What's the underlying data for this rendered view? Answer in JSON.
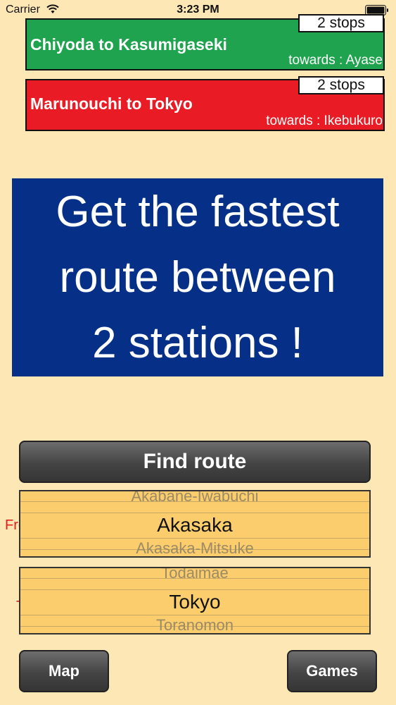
{
  "status_bar": {
    "carrier": "Carrier",
    "time": "3:23 PM",
    "wifi_icon": "wifi-icon",
    "battery_icon": "battery-icon"
  },
  "routes": [
    {
      "title": "Chiyoda to Kasumigaseki",
      "towards": "towards : Ayase",
      "stops": "2 stops",
      "color": "#1fa34e"
    },
    {
      "title": "Marunouchi to Tokyo",
      "towards": "towards : Ikebukuro",
      "stops": "2 stops",
      "color": "#e91b24"
    }
  ],
  "banner": {
    "line1": "Get the fastest",
    "line2": "route between",
    "line3": "2 stations !",
    "color": "#063087"
  },
  "find_route_label": "Find route",
  "from_picker": {
    "label": "From",
    "above": "Akabane-Iwabuchi",
    "selected": "Akasaka",
    "below": "Akasaka-Mitsuke"
  },
  "to_picker": {
    "label": "To",
    "above": "Todaimae",
    "selected": "Tokyo",
    "below": "Toranomon"
  },
  "buttons": {
    "map_label": "Map",
    "games_label": "Games"
  },
  "colors": {
    "background": "#fde8b5",
    "picker": "#fccd6c",
    "picker_label": "#e0201d"
  }
}
